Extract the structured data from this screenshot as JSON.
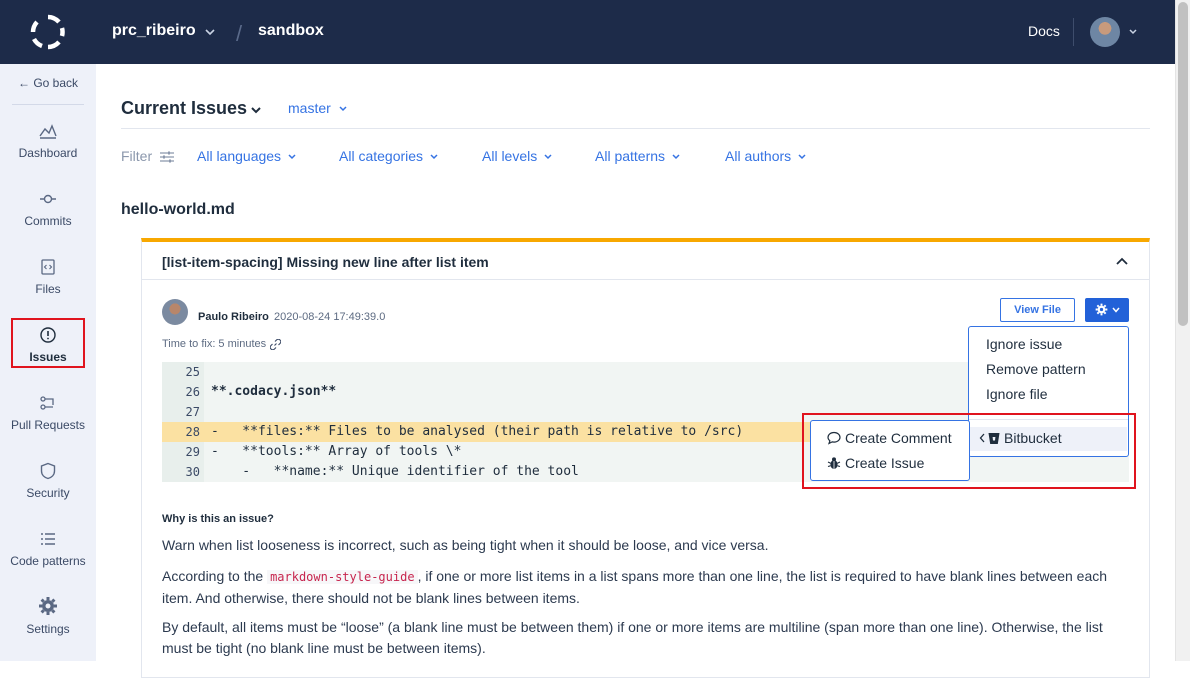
{
  "topbar": {
    "org": "prc_ribeiro",
    "repo": "sandbox",
    "docs": "Docs"
  },
  "sidebar": {
    "go_back": "← Go back",
    "items": [
      {
        "label": "Dashboard",
        "icon": "chart-icon"
      },
      {
        "label": "Commits",
        "icon": "commit-icon"
      },
      {
        "label": "Files",
        "icon": "file-code-icon"
      },
      {
        "label": "Issues",
        "icon": "alert-circle-icon",
        "active": true
      },
      {
        "label": "Pull Requests",
        "icon": "pull-request-icon"
      },
      {
        "label": "Security",
        "icon": "shield-icon"
      },
      {
        "label": "Code patterns",
        "icon": "list-icon"
      },
      {
        "label": "Settings",
        "icon": "gear-icon"
      }
    ]
  },
  "main": {
    "title": "Current Issues",
    "branch": "master",
    "filter_label": "Filter",
    "filters": [
      "All languages",
      "All categories",
      "All levels",
      "All patterns",
      "All authors"
    ],
    "filename": "hello-world.md"
  },
  "issue": {
    "title": "[list-item-spacing] Missing new line after list item",
    "author": "Paulo Ribeiro",
    "date": "2020-08-24 17:49:39.0",
    "time_to_fix": "Time to fix: 5 minutes",
    "view_file": "View File",
    "code": [
      {
        "line": "25",
        "text": ""
      },
      {
        "line": "26",
        "text": "**.codacy.json**"
      },
      {
        "line": "27",
        "text": ""
      },
      {
        "line": "28",
        "text": "-   **files:** Files to be analysed (their path is relative to /src)",
        "highlight": true
      },
      {
        "line": "29",
        "text": "-   **tools:** Array of tools \\*"
      },
      {
        "line": "30",
        "text": "    -   **name:** Unique identifier of the tool"
      }
    ],
    "why_heading": "Why is this an issue?",
    "para1": "Warn when list looseness is incorrect, such as being tight when it should be loose, and vice versa.",
    "para2_pre": "According to the ",
    "para2_code": "markdown-style-guide",
    "para2_post": ", if one or more list items in a list spans more than one line, the list is required to have blank lines between each item. And otherwise, there should not be blank lines between items.",
    "para3": "By default, all items must be “loose” (a blank line must be between them) if one or more items are multiline (span more than one line). Otherwise, the list must be tight (no blank line must be between items)."
  },
  "menu": {
    "items": [
      "Ignore issue",
      "Remove pattern",
      "Ignore file"
    ],
    "bitbucket": "Bitbucket",
    "submenu": [
      "Create Comment",
      "Create Issue"
    ]
  },
  "colors": {
    "topbar": "#1d2b49",
    "accent": "#3573e3",
    "warning": "#f8a800",
    "highlight_box": "#e0141e"
  }
}
